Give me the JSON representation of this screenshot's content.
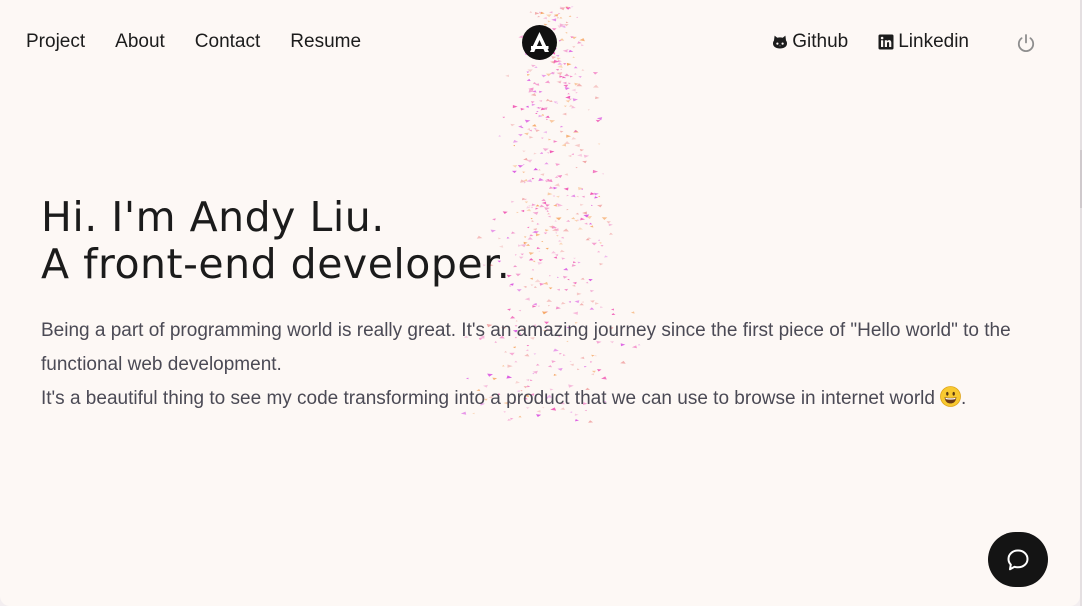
{
  "nav": {
    "links": [
      "Project",
      "About",
      "Contact",
      "Resume"
    ],
    "logo_icon": "letter-a-logo-icon",
    "github_label": "Github",
    "github_icon": "github-icon",
    "linkedin_label": "Linkedin",
    "linkedin_icon": "linkedin-icon",
    "power_icon": "power-icon"
  },
  "hero": {
    "line1": "Hi. I'm Andy Liu.",
    "line2": "A front-end developer.",
    "paragraph1": "Being a part of programming world is really great. It's an amazing journey since the first piece of \"Hello world\" to the functional web development.",
    "paragraph2": "It's a beautiful thing to see my code transforming into a product that we can use to browse in internet world",
    "paragraph2_end": ".",
    "emoji_icon": "grinning-face-emoji-icon"
  },
  "chat_button": {
    "icon": "chat-bubble-icon"
  },
  "colors": {
    "background": "#fdf8f5",
    "text_dark": "#1b1b1b",
    "text_body": "#4b4a55",
    "particle_pink": "#ef4fb0",
    "particle_orange": "#f5a25c",
    "chat_button": "#141414"
  }
}
